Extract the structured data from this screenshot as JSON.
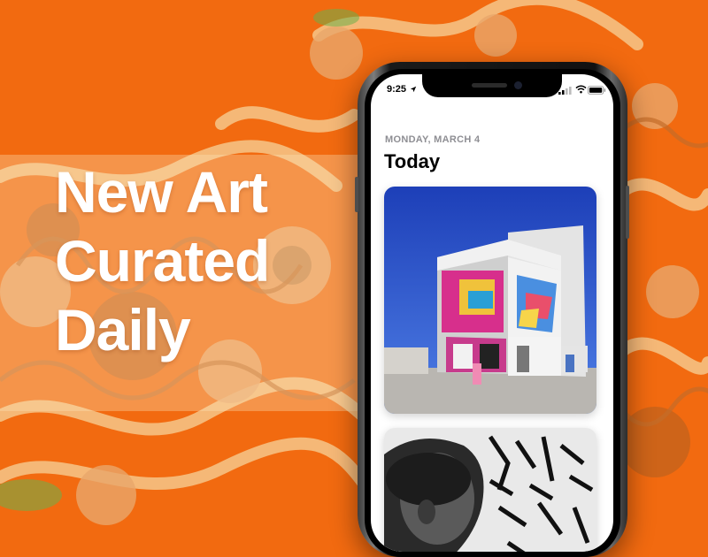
{
  "headline": [
    "New Art",
    "Curated",
    "Daily"
  ],
  "status_bar": {
    "time": "9:25"
  },
  "today": {
    "date_label": "MONDAY, MARCH 4",
    "title": "Today"
  },
  "cards": [
    {
      "subject": "graffiti-covered building photo"
    },
    {
      "subject": "portrait in front of black and white calligraffiti wall"
    }
  ],
  "colors": {
    "background": "#f26a10",
    "headline": "#ffffff",
    "date_label": "#8e8e93"
  },
  "icons": [
    "location-arrow-icon",
    "cellular-signal-icon",
    "wifi-icon",
    "battery-icon"
  ]
}
